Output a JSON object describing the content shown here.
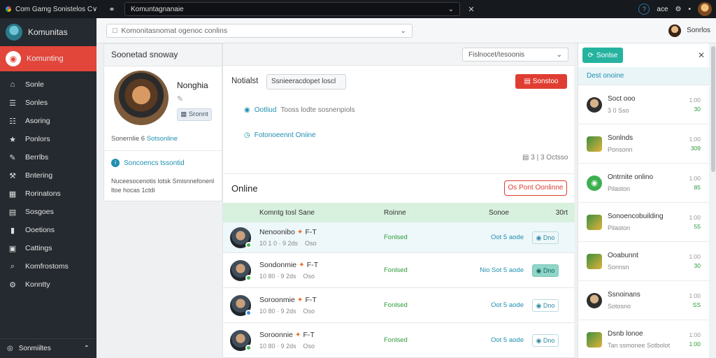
{
  "topbar": {
    "tab_title": "Com Gamg  Sonistelos C∨",
    "search_value": "Komuntagnanaie",
    "right_text": "асе"
  },
  "sidebar": {
    "title": "Komunitas",
    "active": "Komunting",
    "items": [
      {
        "label": "Sonle",
        "icon": "home-icon",
        "glyph": "⌂"
      },
      {
        "label": "Sonles",
        "icon": "people-icon",
        "glyph": "☰"
      },
      {
        "label": "Asoring",
        "icon": "list-icon",
        "glyph": "☷"
      },
      {
        "label": "Ponlors",
        "icon": "star-icon",
        "glyph": "★"
      },
      {
        "label": "Berrlbs",
        "icon": "pin-icon",
        "glyph": "✎"
      },
      {
        "label": "Bntering",
        "icon": "tool-icon",
        "glyph": "⚒"
      },
      {
        "label": "Rorinatons",
        "icon": "calendar-icon",
        "glyph": "▦"
      },
      {
        "label": "Sosgoes",
        "icon": "chat-icon",
        "glyph": "▤"
      },
      {
        "label": "Ooetions",
        "icon": "book-icon",
        "glyph": "▮"
      },
      {
        "label": "Cattings",
        "icon": "image-icon",
        "glyph": "▣"
      },
      {
        "label": "Komfrostoms",
        "icon": "search-icon",
        "glyph": "⌕"
      },
      {
        "label": "Konntty",
        "icon": "gear-icon",
        "glyph": "⚙"
      }
    ],
    "footer": "Sonmiiltes"
  },
  "subheader": {
    "search_value": "Komonitasnomat ogenoc conlins",
    "user_name": "Sonrlos"
  },
  "profile": {
    "title": "Soonetad snoway",
    "name": "Nonghia",
    "button": "Sronnt",
    "meta_prefix": "Sonernlie 6",
    "meta_highlight": "Sotsonline",
    "link": "Soncoencs tssontid",
    "description": "Nuceesocenotis lotsk Smisnnefonenl ltoe hocas 1ctdi"
  },
  "main": {
    "select_value": "Fislnocet/tesoonis",
    "label": "Notialst",
    "field_value": "Ssnieeracdopet loscl",
    "red_button": "Sonstoo",
    "info_highlight": "Ootliud",
    "info_text": "Tooss lodte sosnenpiols",
    "online_link": "Fotonoeennt Oniine",
    "count_text": "3 | 3 Octsso",
    "online_title": "Online",
    "outline_button": "Os Pont Oonlinne",
    "table_head": {
      "name": "Komntg tosl Sane",
      "role": "Roinne",
      "status": "Sonoe",
      "count": "30rt"
    },
    "rows": [
      {
        "name": "Nenoonibo",
        "tag": "F-T",
        "sub": "10 1 0 · 9 2ds    Oso",
        "role": "Fonlsed",
        "score": "Oot 5 aode",
        "action": "Dno",
        "on": false,
        "status": "green"
      },
      {
        "name": "Sondonmie",
        "tag": "F-T",
        "sub": "10 80 · 9 2ds    Oso",
        "role": "Fonlsed",
        "score": "Nio Sot 5 aode",
        "action": "Dno",
        "on": true,
        "status": "green"
      },
      {
        "name": "Soroonmie",
        "tag": "F-T",
        "sub": "10 80 · 9 2ds    Oso",
        "role": "Fonlsed",
        "score": "Oot 5 aode",
        "action": "Dno",
        "on": false,
        "status": "blue"
      },
      {
        "name": "Soroonnie",
        "tag": "F-T",
        "sub": "10 80 · 9 2ds    Oso",
        "role": "Fonlsed",
        "score": "Oot 5 aode",
        "action": "Dno",
        "on": false,
        "status": "green"
      }
    ]
  },
  "right_panel": {
    "pill": "Sonlse",
    "header": "Dest onoine",
    "items": [
      {
        "name": "Soct ooo",
        "sub": "3 0 Sso",
        "time": "1:00",
        "value": "30",
        "av": "c"
      },
      {
        "name": "Sonlnds",
        "sub": "Ponsonn",
        "time": "1:00",
        "value": "309",
        "av": "s"
      },
      {
        "name": "Ontrnite onlino",
        "sub": "Pilaston",
        "time": "1:00",
        "value": "85",
        "av": "g"
      },
      {
        "name": "Sonoencobuilding",
        "sub": "Pilaston",
        "time": "1:00",
        "value": "55",
        "av": "s"
      },
      {
        "name": "Ooabunnt",
        "sub": "Sonnsn",
        "time": "1:00",
        "value": "30",
        "av": "s"
      },
      {
        "name": "Ssnoinans",
        "sub": "Sotosno",
        "time": "1:00",
        "value": "SS",
        "av": "c"
      },
      {
        "name": "Dsnb lonoe",
        "sub": "Tan ssmonee Sotbolot",
        "time": "1:00",
        "value": "1:00",
        "av": "s"
      }
    ]
  }
}
